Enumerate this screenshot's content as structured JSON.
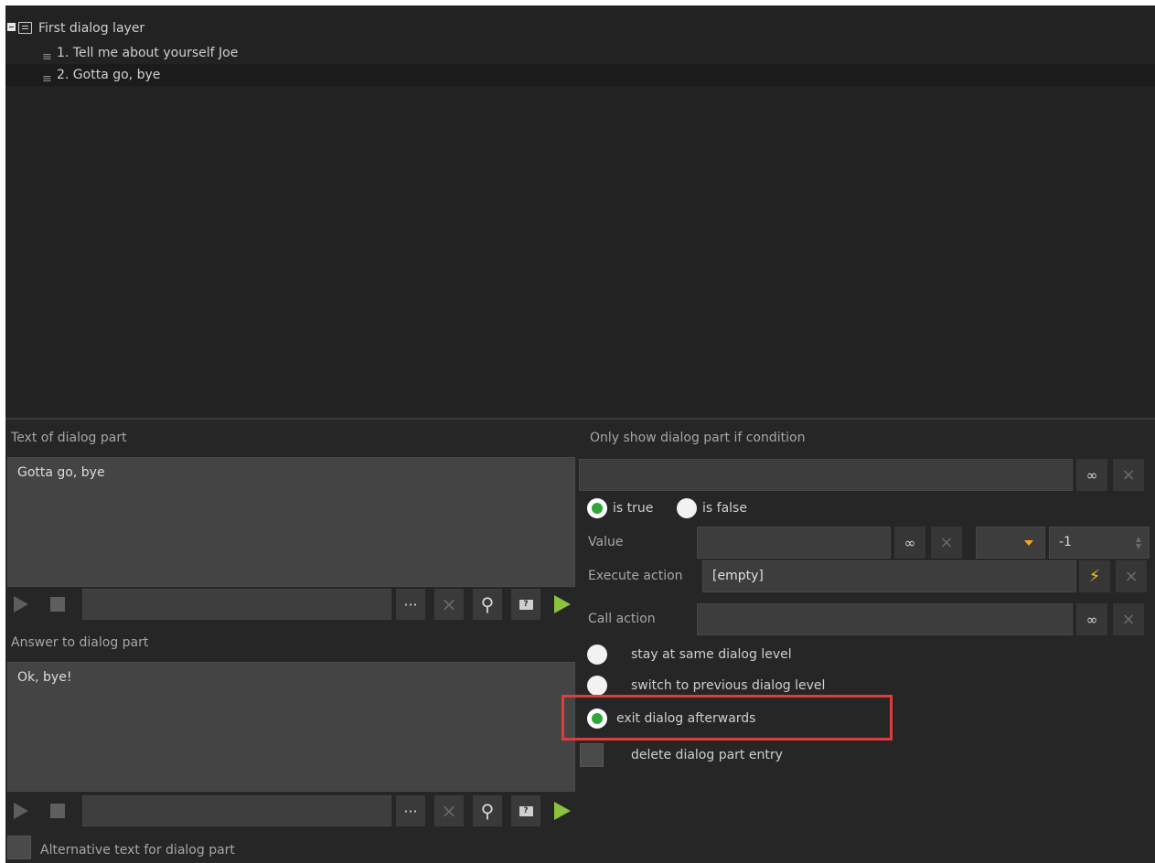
{
  "tree": {
    "root_label": "First dialog layer",
    "children": [
      {
        "label": "1. Tell me about yourself Joe"
      },
      {
        "label": "2. Gotta go, bye"
      }
    ]
  },
  "left": {
    "text_label": "Text of dialog part",
    "text_value": "Gotta go, bye",
    "answer_label": "Answer to dialog part",
    "answer_value": "Ok, bye!",
    "alt_text_label": "Alternative text for dialog part",
    "ellipsis": "···"
  },
  "right": {
    "condition_label": "Only show dialog part if condition",
    "is_true_label": "is true",
    "is_false_label": "is false",
    "value_label": "Value",
    "spin_value": "-1",
    "execute_label": "Execute action",
    "execute_value": "[empty]",
    "call_label": "Call action",
    "opt_stay": "stay at same dialog level",
    "opt_prev": "switch to previous dialog level",
    "opt_exit": "exit dialog afterwards",
    "opt_delete": "delete dialog part entry"
  },
  "colors": {
    "accent_green": "#8bc23e",
    "radio_on": "#2fa83a",
    "highlight": "#e03c3c",
    "bolt": "#f5c125"
  }
}
